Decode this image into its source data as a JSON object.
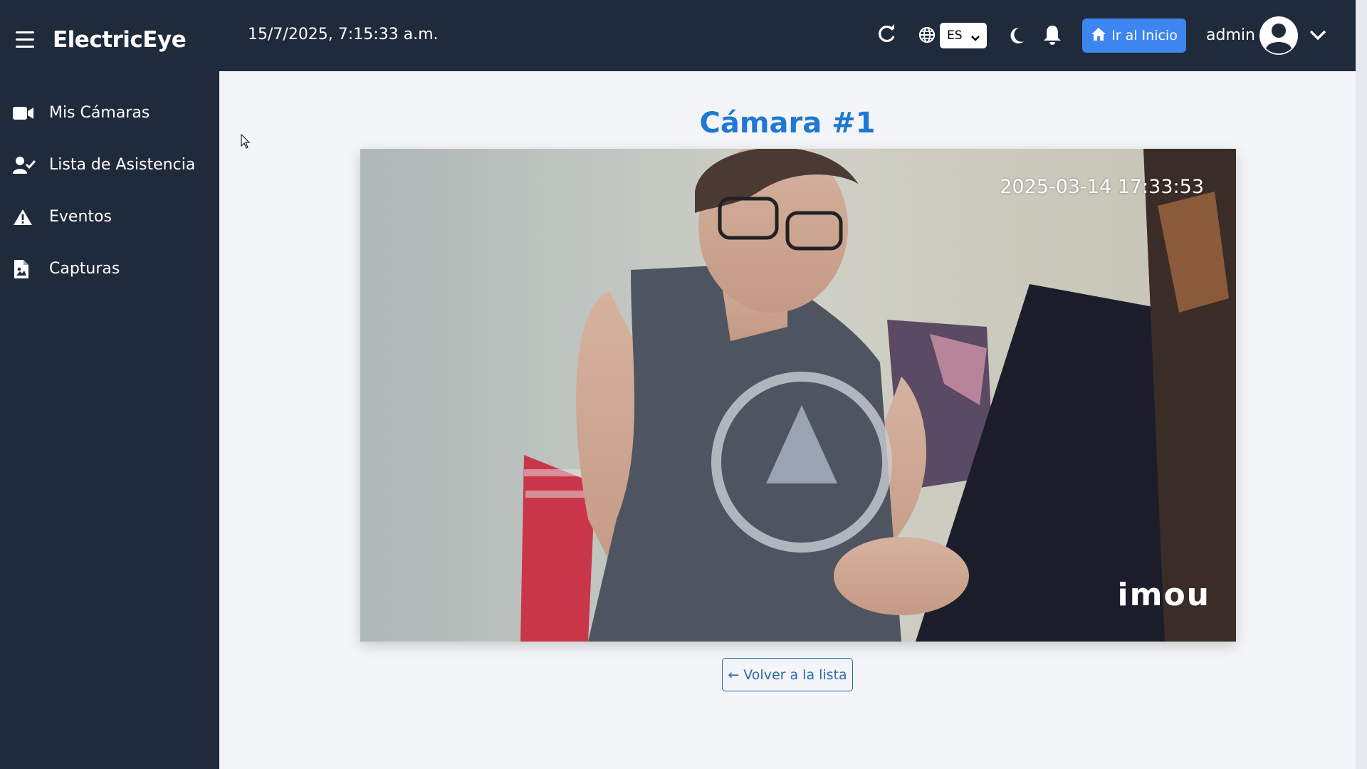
{
  "app": {
    "brand": "ElectricEye"
  },
  "sidebar": {
    "items": [
      {
        "label": "Mis Cámaras",
        "icon": "video-camera-icon"
      },
      {
        "label": "Lista de Asistencia",
        "icon": "user-check-icon"
      },
      {
        "label": "Eventos",
        "icon": "warning-icon"
      },
      {
        "label": "Capturas",
        "icon": "file-image-icon"
      }
    ]
  },
  "header": {
    "datetime": "15/7/2025, 7:15:33 a.m.",
    "language": "ES",
    "home_button": "Ir al Inicio",
    "username": "admin"
  },
  "main": {
    "title": "Cámara #1",
    "camera_timestamp": "2025-03-14 17:33:53",
    "camera_brand": "imou",
    "back_button": "← Volver a la lista"
  },
  "colors": {
    "sidebar_bg": "#1f2a3a",
    "accent": "#3d86f0",
    "title": "#1f78d1",
    "back_button": "#2d6aa8"
  }
}
